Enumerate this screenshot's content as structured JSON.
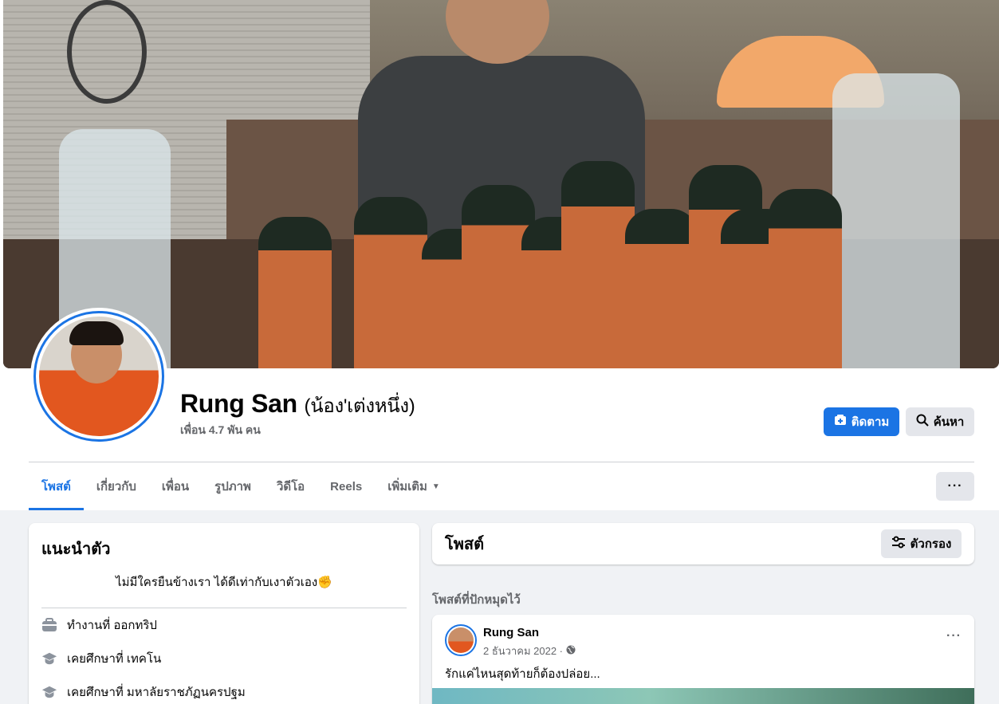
{
  "profile": {
    "name": "Rung San",
    "alt_name": "(น้อง'เต่งหนึ่ง)",
    "friends": "เพื่อน 4.7 พัน คน"
  },
  "actions": {
    "follow_label": "ติดตาม",
    "search_label": "ค้นหา"
  },
  "tabs": [
    {
      "label": "โพสต์",
      "active": true
    },
    {
      "label": "เกี่ยวกับ"
    },
    {
      "label": "เพื่อน"
    },
    {
      "label": "รูปภาพ"
    },
    {
      "label": "วิดีโอ"
    },
    {
      "label": "Reels"
    },
    {
      "label": "เพิ่มเติม"
    }
  ],
  "more_menu": "···",
  "intro": {
    "title": "แนะนำตัว",
    "bio": "ไม่มีใครยืนข้างเรา ได้ดีเท่ากับเงาตัวเอง✊",
    "items": [
      {
        "icon": "briefcase-icon",
        "text": "ทำงานที่ ออกทริป"
      },
      {
        "icon": "graduation-cap-icon",
        "text": "เคยศึกษาที่ เทคโน"
      },
      {
        "icon": "graduation-cap-icon",
        "text": "เคยศึกษาที่ มหาลัยราชภัฏนครปฐม"
      }
    ]
  },
  "posts": {
    "title": "โพสต์",
    "filter_label": "ตัวกรอง",
    "pinned_label": "โพสต์ที่ปักหมุดไว้"
  },
  "post": {
    "author": "Rung San",
    "date": "2 ธันวาคม 2022 ·",
    "privacy_icon": "globe-icon",
    "text": "รักแค่ไหนสุดท้ายก็ต้องปล่อย...",
    "menu": "···"
  },
  "colors": {
    "accent": "#1b74e4",
    "background": "#f0f2f5",
    "secondary_text": "#65676b",
    "button_gray": "#e4e6eb"
  }
}
